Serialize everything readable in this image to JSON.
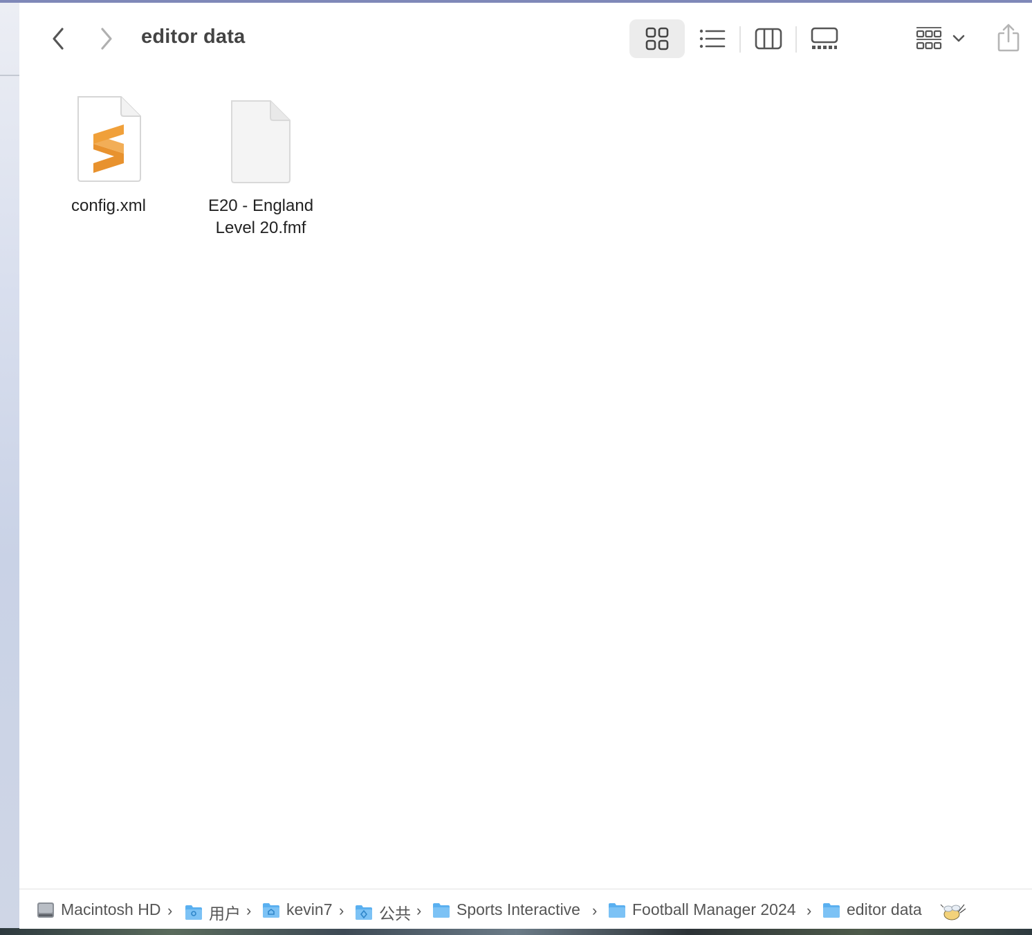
{
  "window": {
    "title": "editor data"
  },
  "toolbar": {
    "back_icon": "chevron-left-icon",
    "forward_icon": "chevron-right-icon",
    "views": [
      {
        "name": "icon-view",
        "icon": "grid-icon",
        "active": true
      },
      {
        "name": "list-view",
        "icon": "list-icon",
        "active": false
      },
      {
        "name": "column-view",
        "icon": "columns-icon",
        "active": false
      },
      {
        "name": "gallery-view",
        "icon": "gallery-icon",
        "active": false
      }
    ],
    "group_icon": "group-grid-icon",
    "share_icon": "share-icon"
  },
  "files": [
    {
      "name_line1": "config.xml",
      "name_line2": "",
      "icon": "sublime-text-document-icon"
    },
    {
      "name_line1": "E20 - England",
      "name_line2": "Level 20.fmf",
      "icon": "blank-document-icon"
    }
  ],
  "pathbar": {
    "crumbs": [
      {
        "label": "Macintosh HD",
        "icon": "hard-drive-icon"
      },
      {
        "label": "用户",
        "icon": "users-folder-icon"
      },
      {
        "label": "kevin7",
        "icon": "home-folder-icon"
      },
      {
        "label": "公共",
        "icon": "public-folder-icon"
      },
      {
        "label": "Sports Interactive",
        "icon": "folder-icon"
      },
      {
        "label": "Football Manager 2024",
        "icon": "folder-icon"
      },
      {
        "label": "editor data",
        "icon": "folder-icon"
      }
    ],
    "separator": "›"
  },
  "colors": {
    "accent_orange": "#F0A03A",
    "folder_blue": "#5AB0F0",
    "active_view_bg": "#ECECEC"
  }
}
